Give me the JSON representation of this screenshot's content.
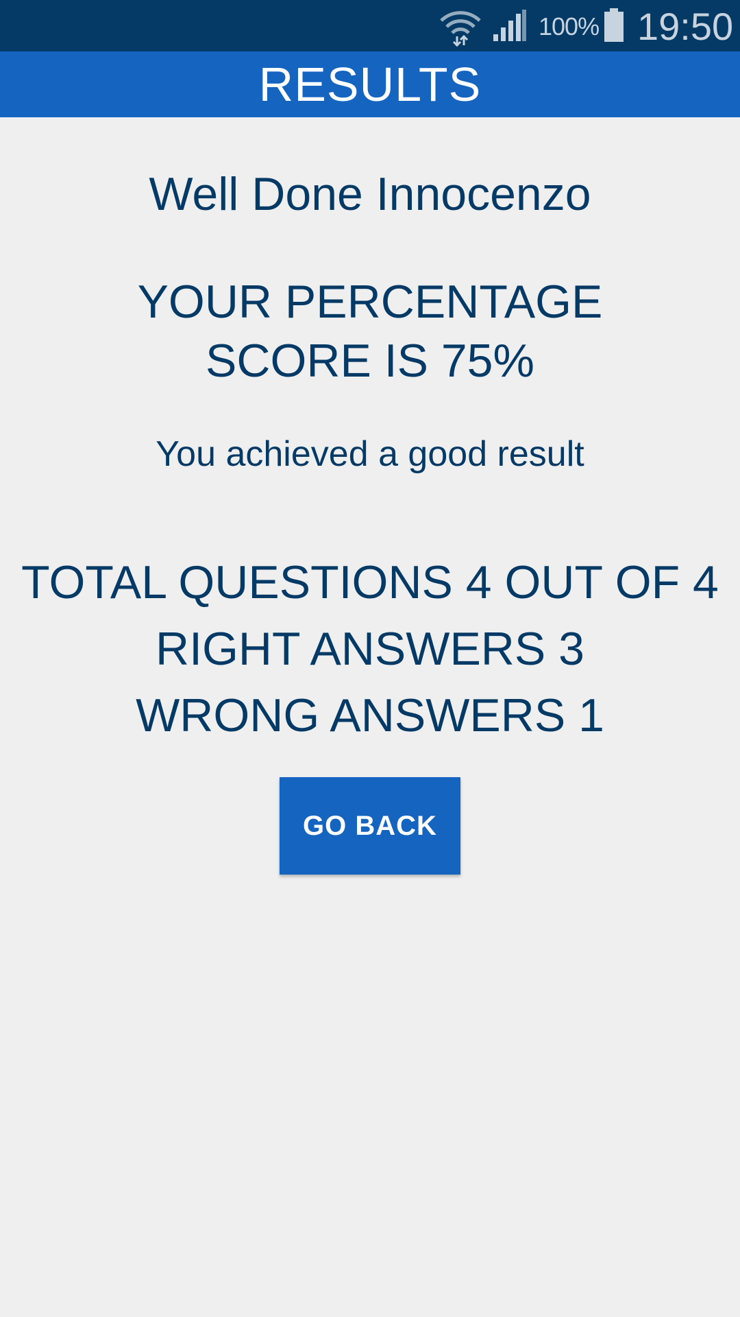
{
  "status_bar": {
    "battery_percent": "100%",
    "time": "19:50",
    "icons": [
      "wifi-icon",
      "signal-icon",
      "battery-icon"
    ],
    "background_color": "#063a66",
    "icon_color": "#c7d3de"
  },
  "app_bar": {
    "title": "RESULTS",
    "background_color": "#1565c0"
  },
  "results": {
    "greeting": "Well Done Innocenzo",
    "score_line_1": "YOUR PERCENTAGE",
    "score_line_2": "SCORE IS 75%",
    "feedback": "You achieved a good result",
    "total_questions": "TOTAL QUESTIONS 4 OUT OF 4",
    "right_answers": "RIGHT ANSWERS 3",
    "wrong_answers": "WRONG ANSWERS 1",
    "text_color": "#063a66"
  },
  "actions": {
    "go_back_label": "GO BACK",
    "button_color": "#1565c0"
  },
  "page": {
    "background_color": "#efeff0"
  }
}
